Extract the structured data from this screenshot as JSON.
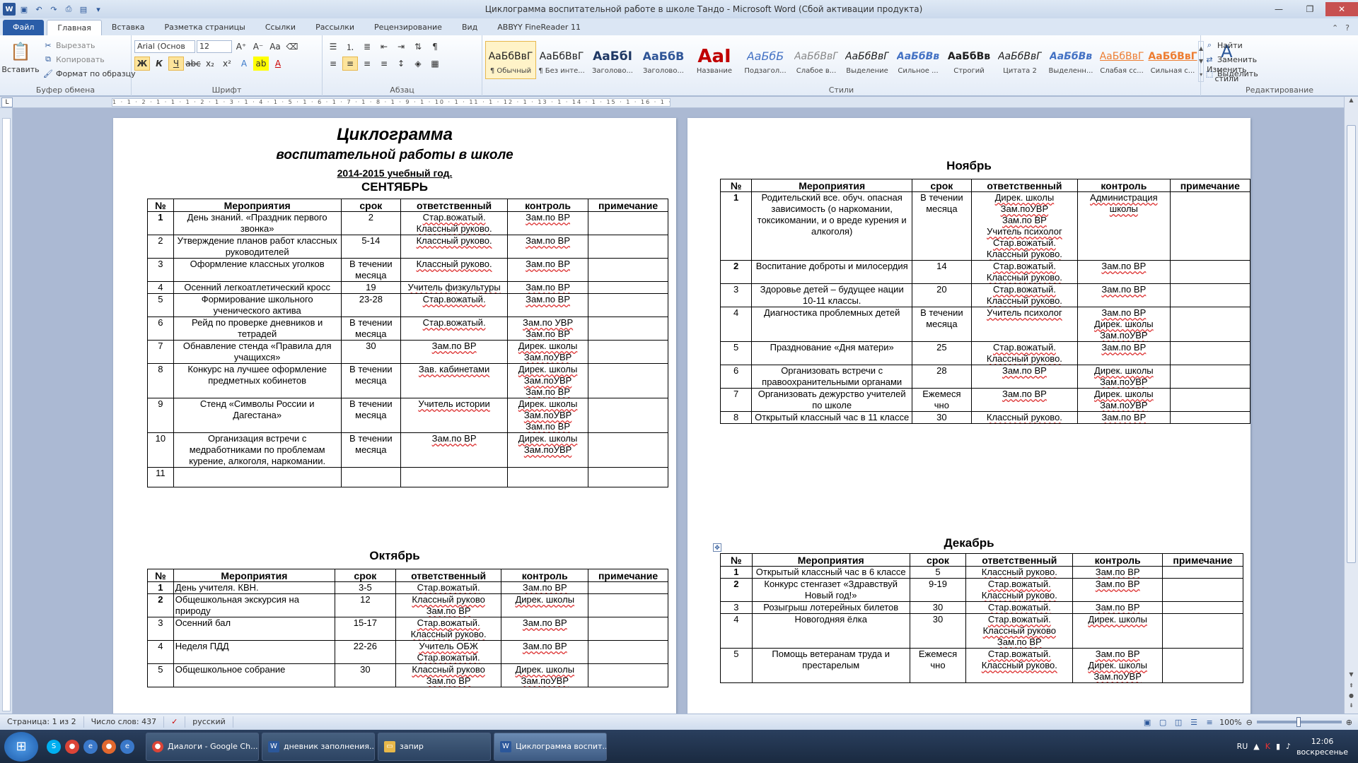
{
  "window": {
    "title": "Циклограмма воспитательной работе в школе Тандо  -  Microsoft Word (Сбой активации продукта)"
  },
  "tabs": [
    "Файл",
    "Главная",
    "Вставка",
    "Разметка страницы",
    "Ссылки",
    "Рассылки",
    "Рецензирование",
    "Вид",
    "ABBYY FineReader 11"
  ],
  "clipboard": {
    "paste": "Вставить",
    "cut": "Вырезать",
    "copy": "Копировать",
    "format": "Формат по образцу",
    "label": "Буфер обмена"
  },
  "font": {
    "name": "Arial (Основ",
    "size": "12",
    "label": "Шрифт"
  },
  "paragraph": {
    "label": "Абзац"
  },
  "styles": {
    "label": "Стили",
    "items": [
      {
        "preview": "АаБбВвГ",
        "name": "¶ Обычный"
      },
      {
        "preview": "АаБбВвГ",
        "name": "¶ Без инте..."
      },
      {
        "preview": "АаБбI",
        "name": "Заголово..."
      },
      {
        "preview": "АаБбВ",
        "name": "Заголово..."
      },
      {
        "preview": "АаI",
        "name": "Название"
      },
      {
        "preview": "АаБбБ",
        "name": "Подзагол..."
      },
      {
        "preview": "АаБбВвГ",
        "name": "Слабое в..."
      },
      {
        "preview": "АаБбВвГ",
        "name": "Выделение"
      },
      {
        "preview": "АаБбВв",
        "name": "Сильное ..."
      },
      {
        "preview": "АаБбВв",
        "name": "Строгий"
      },
      {
        "preview": "АаБбВвГ",
        "name": "Цитата 2"
      },
      {
        "preview": "АаБбВв",
        "name": "Выделенн..."
      },
      {
        "preview": "АаБбВвГ",
        "name": "Слабая сс..."
      },
      {
        "preview": "АаБбВвГ",
        "name": "Сильная с..."
      }
    ],
    "change": "Изменить стили"
  },
  "editing": {
    "find": "Найти",
    "replace": "Заменить",
    "select": "Выделить",
    "label": "Редактирование"
  },
  "ruler": {
    "marks": "1 · 1 · 2 · 1 · 1 · 1 · 2 · 1 · 3 · 1 · 4 · 1 · 5 · 1 · 6 · 1 · 7 · 1 · 8 · 1 · 9 · 1 · 10 · 1 · 11 · 1 · 12 · 1 · 13 · 1 · 14 · 1 · 15 · 1 · 16 · 1 · 17 · 1"
  },
  "doc": {
    "title": "Циклограмма",
    "subtitle": "воспитательной работы в школе",
    "year": "2014-2015 учебный год.",
    "headers": [
      "№",
      "Мероприятия",
      "срок",
      "ответственный",
      "контроль",
      "примечание"
    ],
    "months": [
      {
        "name": "СЕНТЯБРЬ",
        "rows": [
          [
            "1",
            "День знаний. «Праздник первого звонка»",
            "2",
            "Стар.вожатый.\nКлассный руково.",
            "Зам.по ВР",
            ""
          ],
          [
            "2",
            "Утверждение планов работ классных руководителей",
            "5-14",
            "Классный руково.",
            "Зам.по ВР",
            ""
          ],
          [
            "3",
            "Оформление  классных уголков",
            "В течении месяца",
            "Классный руково.",
            "Зам.по ВР",
            ""
          ],
          [
            "4",
            "Осенний легкоатлетический кросс",
            "19",
            "Учитель физкультуры",
            "Зам.по ВР",
            ""
          ],
          [
            "5",
            "Формирование  школьного ученического актива",
            "23-28",
            "Стар.вожатый.",
            "Зам.по ВР",
            ""
          ],
          [
            "6",
            "Рейд по проверке дневников и тетрадей",
            "В течении месяца",
            "Стар.вожатый.",
            "Зам.по УВР\nЗам.по ВР",
            ""
          ],
          [
            "7",
            "Обнавление стенда «Правила для учащихся»",
            "30",
            "Зам.по ВР",
            "Дирек. школы\nЗам.поУВР",
            ""
          ],
          [
            "8",
            "Конкурс на лучшее оформление предметных кобинетов",
            "В течении месяца",
            "Зав. кабинетами",
            "Дирек. школы\nЗам.поУВР\nЗам.по ВР",
            ""
          ],
          [
            "9",
            "Стенд «Символы России и Дагестана»",
            "В течении месяца",
            "Учитель истории",
            "Дирек. школы\nЗам.поУВР\nЗам.по ВР",
            ""
          ],
          [
            "10",
            "Организация встречи с медработниками по проблемам курение, алкоголя, наркомании.",
            "В течении месяца",
            "Зам.по ВР",
            "Дирек. школы\nЗам.поУВР",
            ""
          ],
          [
            "11",
            "",
            "",
            "",
            "",
            ""
          ]
        ]
      },
      {
        "name": "Октябрь",
        "rows": [
          [
            "1",
            "День учителя. КВН.",
            "3-5",
            "Стар.вожатый.",
            "Зам.по ВР",
            ""
          ],
          [
            "2",
            "Общешкольная экскурсия на природу",
            "12",
            "Классный руково\nЗам.по ВР",
            "Дирек. школы",
            ""
          ],
          [
            "3",
            "Осенний бал",
            "15-17",
            "Стар.вожатый.\nКлассный руково.",
            "Зам.по ВР",
            ""
          ],
          [
            "4",
            "Неделя ПДД",
            "22-26",
            "Учитель ОБЖ\nСтар.вожатый.",
            "Зам.по ВР",
            ""
          ],
          [
            "5",
            "Общешкольное собрание",
            "30",
            "Классный руково\nЗам.по ВР",
            "Дирек. школы\nЗам.поУВР",
            ""
          ]
        ]
      },
      {
        "name": "Ноябрь",
        "rows": [
          [
            "1",
            "Родительский все. обуч. опасная зависимость (о наркомании, токсикомании,  и о вреде курения и  алкоголя)",
            "В течении месяца",
            "Дирек. школы\nЗам.поУВР\nЗам.по ВР\nУчитель психолог\nСтар.вожатый.\nКлассный руково.",
            "Администрация школы",
            ""
          ],
          [
            "2",
            "Воспитание доброты и милосердия",
            "14",
            "Стар.вожатый.\nКлассный руково.",
            "Зам.по ВР",
            ""
          ],
          [
            "3",
            "Здоровье детей – будущее нации 10-11 классы.",
            "20",
            "Стар.вожатый.\nКлассный руково.",
            "Зам.по ВР",
            ""
          ],
          [
            "4",
            "Диагностика проблемных детей",
            "В течении месяца",
            "Учитель психолог",
            "Зам.по ВР\nДирек. школы\nЗам.поУВР",
            ""
          ],
          [
            "5",
            "Празднование «Дня матери»",
            "25",
            "Стар.вожатый.\nКлассный руково.",
            "Зам.по ВР",
            ""
          ],
          [
            "6",
            "Организовать встречи с правоохранительными органами",
            "28",
            "Зам.по ВР",
            "Дирек. школы\nЗам.поУВР",
            ""
          ],
          [
            "7",
            "Организовать дежурство учителей по школе",
            "Ежемеся чно",
            "Зам.по ВР",
            "Дирек. школы\nЗам.поУВР",
            ""
          ],
          [
            "8",
            "Открытый классный час в 11 классе",
            "30",
            "Классный руково.",
            "Зам.по ВР",
            ""
          ]
        ]
      },
      {
        "name": "Декабрь",
        "rows": [
          [
            "1",
            "Открытый классный час в 6 классе",
            "5",
            "Классный руково.",
            "Зам.по ВР",
            ""
          ],
          [
            "2",
            "Конкурс стенгазет «Здравствуй Новый год!»",
            "9-19",
            "Стар.вожатый.\nКлассный руково.",
            "Зам.по ВР",
            ""
          ],
          [
            "3",
            "Розыгрыш лотерейных билетов",
            "30",
            "Стар.вожатый.",
            "Зам.по ВР",
            ""
          ],
          [
            "4",
            "Новогодняя  ёлка",
            "30",
            "Стар.вожатый.\nКлассный руково\nЗам.по ВР",
            "Дирек. школы",
            ""
          ],
          [
            "5",
            "Помощь ветеранам труда и престарелым",
            "Ежемеся чно",
            "Стар.вожатый.\nКлассный руково.",
            "Зам.по ВР\nДирек. школы\nЗам.поУВР",
            ""
          ]
        ]
      }
    ]
  },
  "status": {
    "page": "Страница: 1 из 2",
    "words": "Число слов: 437",
    "lang": "русский",
    "zoom": "100%"
  },
  "taskbar": {
    "items": [
      {
        "label": "Диалоги - Google Ch...",
        "icon": "chrome-icon"
      },
      {
        "label": "дневник заполнения...",
        "icon": "word-icon"
      },
      {
        "label": "запир",
        "icon": "folder-icon"
      },
      {
        "label": "Циклограмма воспит...",
        "icon": "word-icon"
      }
    ],
    "lang": "RU",
    "time": "12:06",
    "day": "воскресенье"
  }
}
